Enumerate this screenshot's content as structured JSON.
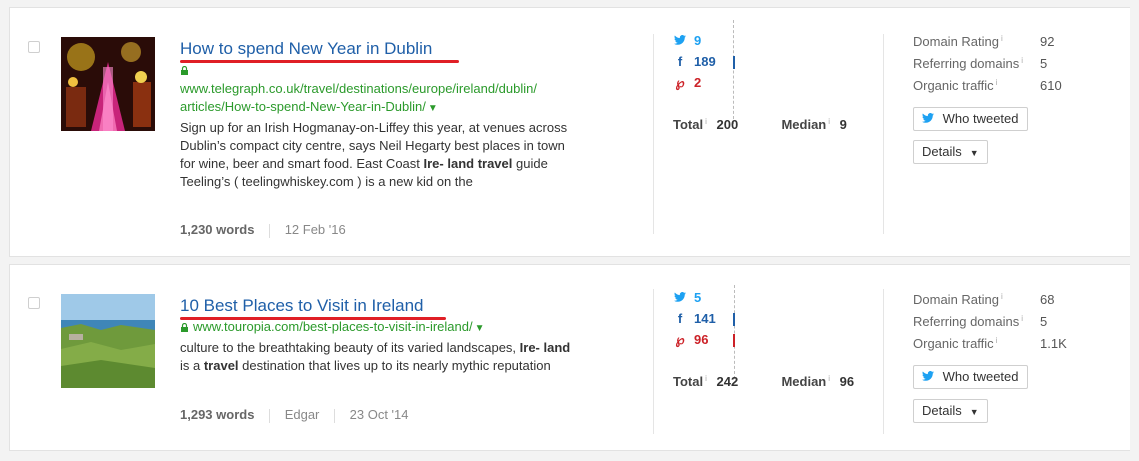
{
  "results": [
    {
      "title": "How to spend New Year in Dublin",
      "url_line1": "www.telegraph.co.uk/travel/destinations/europe/ireland/dublin/",
      "url_line2": "articles/How-to-spend-New-Year-in-Dublin/",
      "snippet": [
        {
          "t": "Sign up for an Irish Hogmanay-on-Liffey this year, at venues across Dublin’s compact city centre, says Neil Hegarty best places in town for wine, beer and smart food. East Coast "
        },
        {
          "t": "Ire- land travel",
          "b": true
        },
        {
          "t": " guide Teeling’s ( teelingwhiskey.com ) is a new kid on the"
        }
      ],
      "words": "1,230 words",
      "author": "",
      "date": "12 Feb '16",
      "twitter": "9",
      "facebook": "189",
      "pinterest": "2",
      "total_label": "Total",
      "total": "200",
      "median_label": "Median",
      "median": "9",
      "domain_rating_label": "Domain Rating",
      "domain_rating": "92",
      "referring_domains_label": "Referring domains",
      "referring_domains": "5",
      "organic_traffic_label": "Organic traffic",
      "organic_traffic": "610",
      "who_tweeted_label": "Who tweeted",
      "details_label": "Details",
      "accent_color": "#e01f26"
    },
    {
      "title": "10 Best Places to Visit in Ireland",
      "url_line1": "www.touropia.com/best-places-to-visit-in-ireland/",
      "url_line2": "",
      "snippet": [
        {
          "t": "culture to the breathtaking beauty of its varied landscapes, "
        },
        {
          "t": "Ire- land",
          "b": true
        },
        {
          "t": " is a "
        },
        {
          "t": "travel",
          "b": true
        },
        {
          "t": " destination that lives up to its nearly mythic reputation"
        }
      ],
      "words": "1,293 words",
      "author": "Edgar",
      "date": "23 Oct '14",
      "twitter": "5",
      "facebook": "141",
      "pinterest": "96",
      "total_label": "Total",
      "total": "242",
      "median_label": "Median",
      "median": "96",
      "domain_rating_label": "Domain Rating",
      "domain_rating": "68",
      "referring_domains_label": "Referring domains",
      "referring_domains": "5",
      "organic_traffic_label": "Organic traffic",
      "organic_traffic": "1.1K",
      "who_tweeted_label": "Who tweeted",
      "details_label": "Details",
      "accent_color": "#e01f26"
    }
  ],
  "icons": {
    "twitter": "twitter-bird-icon",
    "facebook": "facebook-f-icon",
    "pinterest": "pinterest-p-icon",
    "lock": "lock-icon",
    "info": "info-icon",
    "dropdown": "caret-down-icon"
  }
}
